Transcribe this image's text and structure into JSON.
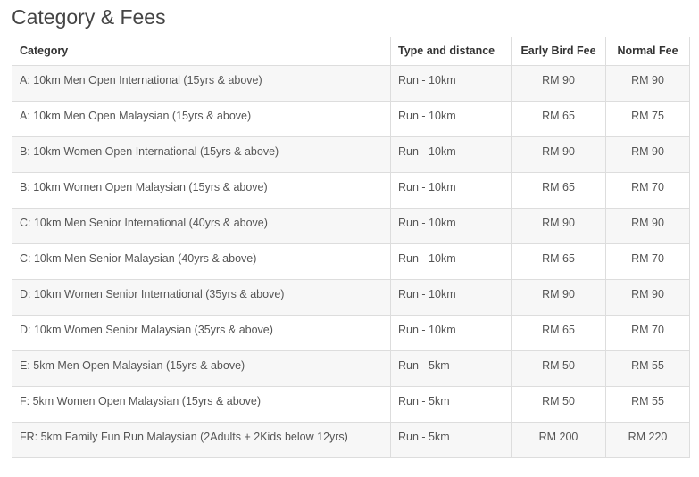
{
  "page": {
    "title": "Category & Fees"
  },
  "table": {
    "headers": {
      "category": "Category",
      "type": "Type and distance",
      "early": "Early Bird Fee",
      "normal": "Normal Fee"
    },
    "rows": [
      {
        "category": "A: 10km Men Open International (15yrs & above)",
        "type": "Run - 10km",
        "early": "RM 90",
        "normal": "RM 90"
      },
      {
        "category": "A: 10km Men Open Malaysian (15yrs & above)",
        "type": "Run - 10km",
        "early": "RM 65",
        "normal": "RM 75"
      },
      {
        "category": "B: 10km Women Open International (15yrs & above)",
        "type": "Run - 10km",
        "early": "RM 90",
        "normal": "RM 90"
      },
      {
        "category": "B: 10km Women Open Malaysian (15yrs & above)",
        "type": "Run - 10km",
        "early": "RM 65",
        "normal": "RM 70"
      },
      {
        "category": "C: 10km Men Senior International (40yrs & above)",
        "type": "Run - 10km",
        "early": "RM 90",
        "normal": "RM 90"
      },
      {
        "category": "C: 10km Men Senior Malaysian (40yrs & above)",
        "type": "Run - 10km",
        "early": "RM 65",
        "normal": "RM 70"
      },
      {
        "category": "D: 10km Women Senior International (35yrs & above)",
        "type": "Run - 10km",
        "early": "RM 90",
        "normal": "RM 90"
      },
      {
        "category": "D: 10km Women Senior Malaysian (35yrs & above)",
        "type": "Run - 10km",
        "early": "RM 65",
        "normal": "RM 70"
      },
      {
        "category": "E: 5km Men Open Malaysian (15yrs & above)",
        "type": "Run - 5km",
        "early": "RM 50",
        "normal": "RM 55"
      },
      {
        "category": "F: 5km Women Open Malaysian (15yrs & above)",
        "type": "Run - 5km",
        "early": "RM 50",
        "normal": "RM 55"
      },
      {
        "category": "FR: 5km Family Fun Run Malaysian (2Adults + 2Kids below 12yrs)",
        "type": "Run - 5km",
        "early": "RM 200",
        "normal": "RM 220"
      }
    ]
  }
}
